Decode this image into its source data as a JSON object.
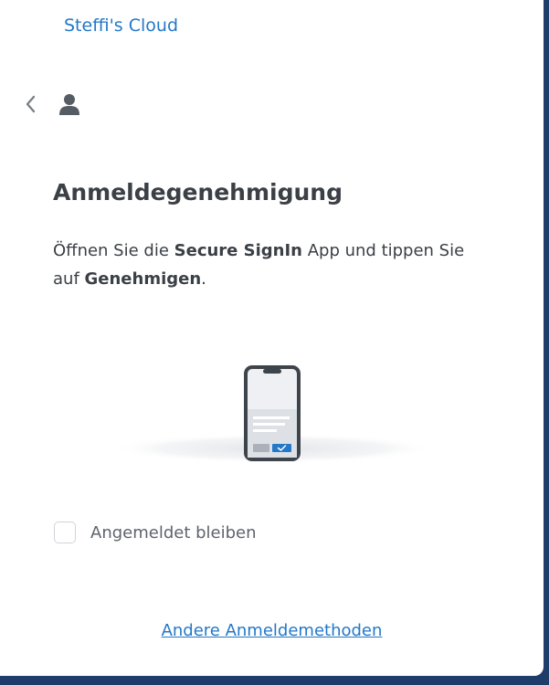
{
  "header": {
    "app_title": "Steffi's Cloud"
  },
  "nav": {
    "back_icon": "chevron-left-icon",
    "user_icon": "user-icon"
  },
  "main": {
    "heading": "Anmeldegenehmigung",
    "instruction": {
      "part1": "Öffnen Sie die ",
      "app_name": "Secure SignIn",
      "part2": " App und tippen Sie auf ",
      "action": "Genehmigen",
      "part3": "."
    },
    "illustration_icon": "phone-approval-icon",
    "remember_me": {
      "label": "Angemeldet bleiben",
      "checked": false
    },
    "other_methods_link": "Andere Anmeldemethoden"
  },
  "colors": {
    "accent": "#2378c8",
    "text": "#3b4046",
    "muted": "#5e646c",
    "background": "#1f3d6b"
  }
}
